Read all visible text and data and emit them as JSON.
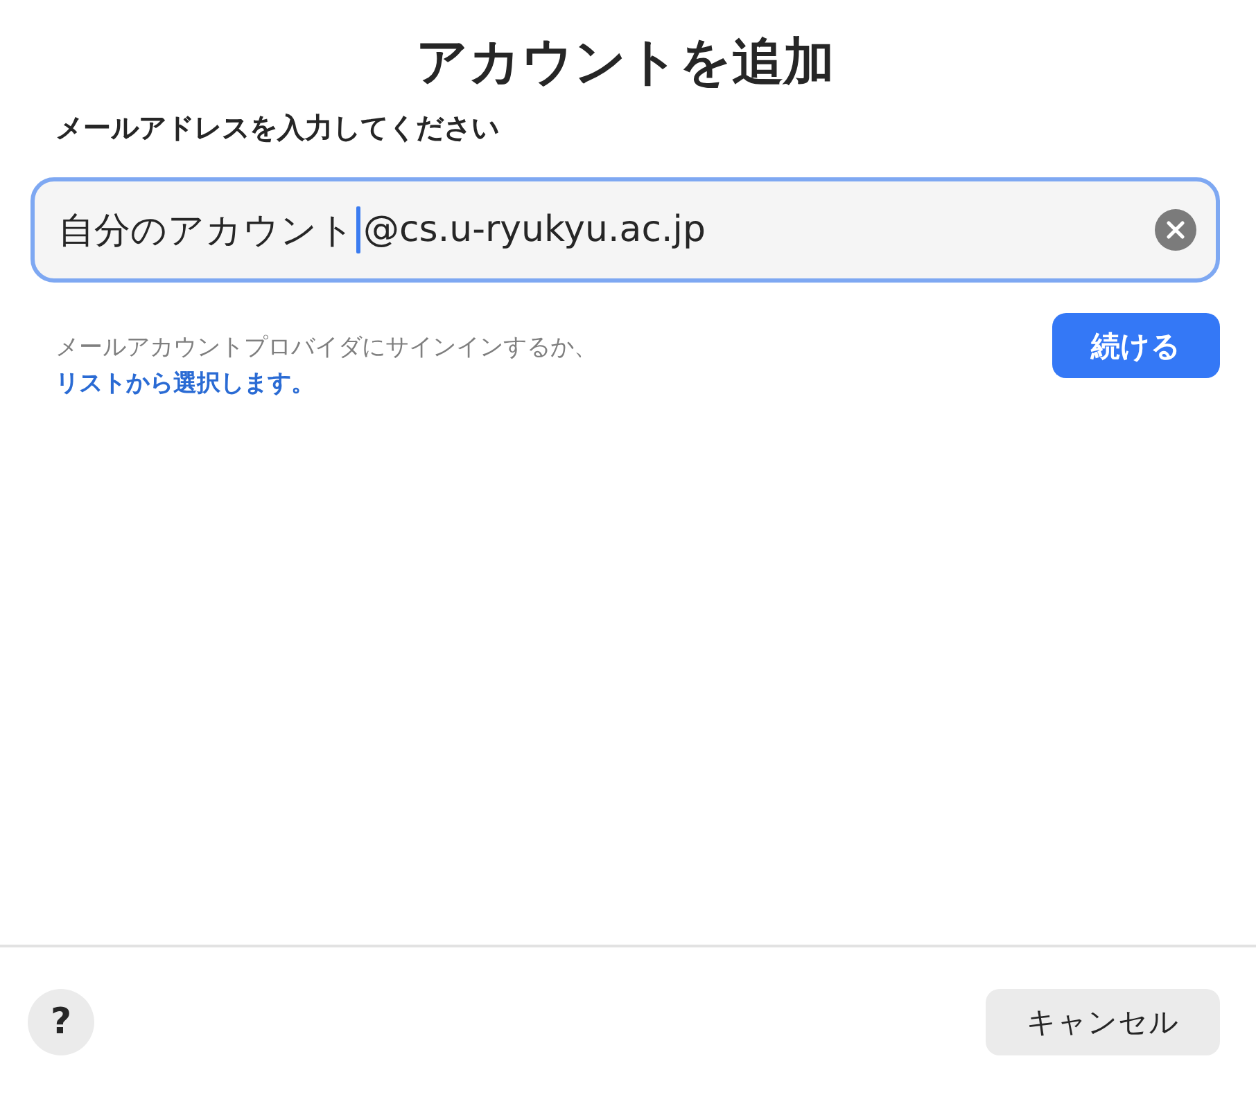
{
  "dialog": {
    "title": "アカウントを追加",
    "subtitle": "メールアドレスを入力してください"
  },
  "email_field": {
    "value_before_cursor": "自分のアカウント",
    "value_after_cursor": "@cs.u-ryukyu.ac.jp",
    "focused": true
  },
  "hint": {
    "text": "メールアカウントプロバイダにサインインするか、",
    "link": "リストから選択します。"
  },
  "continue_button": {
    "label": "続ける"
  },
  "footer": {
    "help_button": {
      "label": "?"
    },
    "cancel_button": {
      "label": "キャンセル"
    }
  }
}
